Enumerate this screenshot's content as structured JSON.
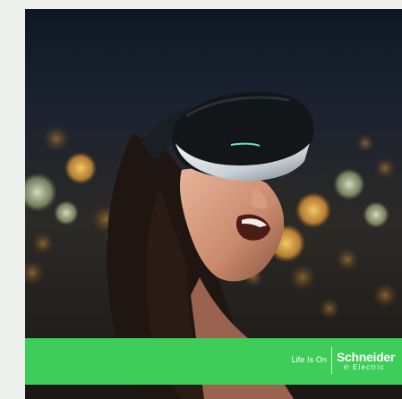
{
  "image": {
    "description_icon": "woman-wearing-vr-headset-photo"
  },
  "brand_bar": {
    "tagline": "Life Is On",
    "logo_name": "Schneider",
    "logo_sub": "Electric",
    "color": "#3dcd58"
  }
}
